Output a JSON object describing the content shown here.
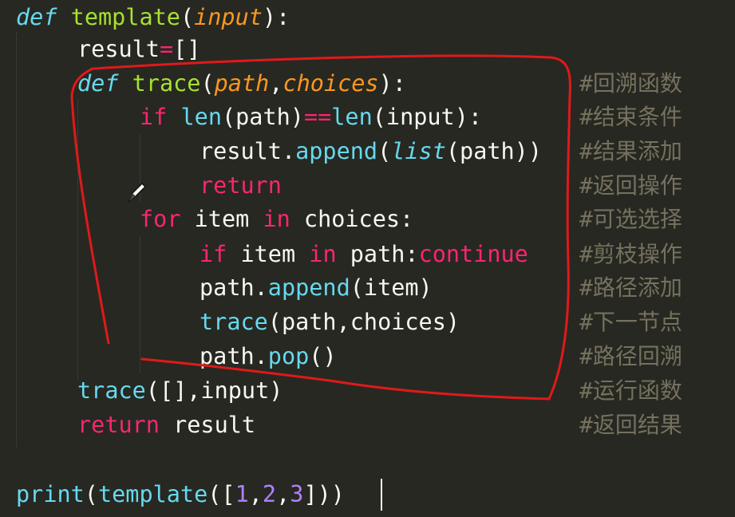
{
  "editor": {
    "lines": [
      {
        "tokens": [
          {
            "t": "def",
            "c": "defkw"
          },
          {
            "t": " "
          },
          {
            "t": "template",
            "c": "fn"
          },
          {
            "t": "("
          },
          {
            "t": "input",
            "c": "param"
          },
          {
            "t": "):"
          }
        ],
        "comment": ""
      },
      {
        "tokens": [
          {
            "t": "result"
          },
          {
            "t": "=",
            "c": "kw"
          },
          {
            "t": "[]"
          }
        ],
        "comment": ""
      },
      {
        "tokens": [
          {
            "t": "def",
            "c": "defkw"
          },
          {
            "t": " "
          },
          {
            "t": "trace",
            "c": "fn"
          },
          {
            "t": "("
          },
          {
            "t": "path",
            "c": "param"
          },
          {
            "t": ","
          },
          {
            "t": "choices",
            "c": "param"
          },
          {
            "t": "):"
          }
        ],
        "comment": "#回溯函数"
      },
      {
        "tokens": [
          {
            "t": "if",
            "c": "kw"
          },
          {
            "t": " "
          },
          {
            "t": "len",
            "c": "builtin"
          },
          {
            "t": "(path)"
          },
          {
            "t": "==",
            "c": "kw"
          },
          {
            "t": "len",
            "c": "builtin"
          },
          {
            "t": "(input):"
          }
        ],
        "comment": "#结束条件"
      },
      {
        "tokens": [
          {
            "t": "result."
          },
          {
            "t": "append",
            "c": "builtin"
          },
          {
            "t": "("
          },
          {
            "t": "list",
            "c": "cls"
          },
          {
            "t": "(path))"
          }
        ],
        "comment": "#结果添加"
      },
      {
        "tokens": [
          {
            "t": "return",
            "c": "kw"
          }
        ],
        "comment": "#返回操作"
      },
      {
        "tokens": [
          {
            "t": "for",
            "c": "kw"
          },
          {
            "t": " item "
          },
          {
            "t": "in",
            "c": "kw"
          },
          {
            "t": " choices:"
          }
        ],
        "comment": "#可选选择"
      },
      {
        "tokens": [
          {
            "t": "if",
            "c": "kw"
          },
          {
            "t": " item "
          },
          {
            "t": "in",
            "c": "kw"
          },
          {
            "t": " path:"
          },
          {
            "t": "continue",
            "c": "kw"
          }
        ],
        "comment": "#剪枝操作"
      },
      {
        "tokens": [
          {
            "t": "path."
          },
          {
            "t": "append",
            "c": "builtin"
          },
          {
            "t": "(item)"
          }
        ],
        "comment": "#路径添加"
      },
      {
        "tokens": [
          {
            "t": "trace",
            "c": "builtin"
          },
          {
            "t": "(path,choices)"
          }
        ],
        "comment": "#下一节点"
      },
      {
        "tokens": [
          {
            "t": "path."
          },
          {
            "t": "pop",
            "c": "builtin"
          },
          {
            "t": "()"
          }
        ],
        "comment": "#路径回溯"
      },
      {
        "tokens": [
          {
            "t": "trace",
            "c": "builtin"
          },
          {
            "t": "([],input)"
          }
        ],
        "comment": "#运行函数"
      },
      {
        "tokens": [
          {
            "t": "return",
            "c": "kw"
          },
          {
            "t": " result"
          }
        ],
        "comment": "#返回结果"
      },
      {
        "tokens": [],
        "comment": ""
      },
      {
        "tokens": [
          {
            "t": "print",
            "c": "builtin"
          },
          {
            "t": "("
          },
          {
            "t": "template",
            "c": "builtin"
          },
          {
            "t": "(["
          },
          {
            "t": "1",
            "c": "num"
          },
          {
            "t": ","
          },
          {
            "t": "2",
            "c": "num"
          },
          {
            "t": ","
          },
          {
            "t": "3",
            "c": "num"
          },
          {
            "t": "]))"
          }
        ],
        "comment": ""
      }
    ]
  },
  "annotation": {
    "color": "#e0191b",
    "shape": "hand-drawn-loop"
  },
  "pen_cursor": {
    "icon": "pen-icon"
  },
  "colors": {
    "background": "#272822",
    "keyword": "#f92672",
    "function": "#a6e22e",
    "parameter": "#fd971f",
    "builtin": "#66d9ef",
    "number": "#ae81ff",
    "comment": "#75715e"
  }
}
